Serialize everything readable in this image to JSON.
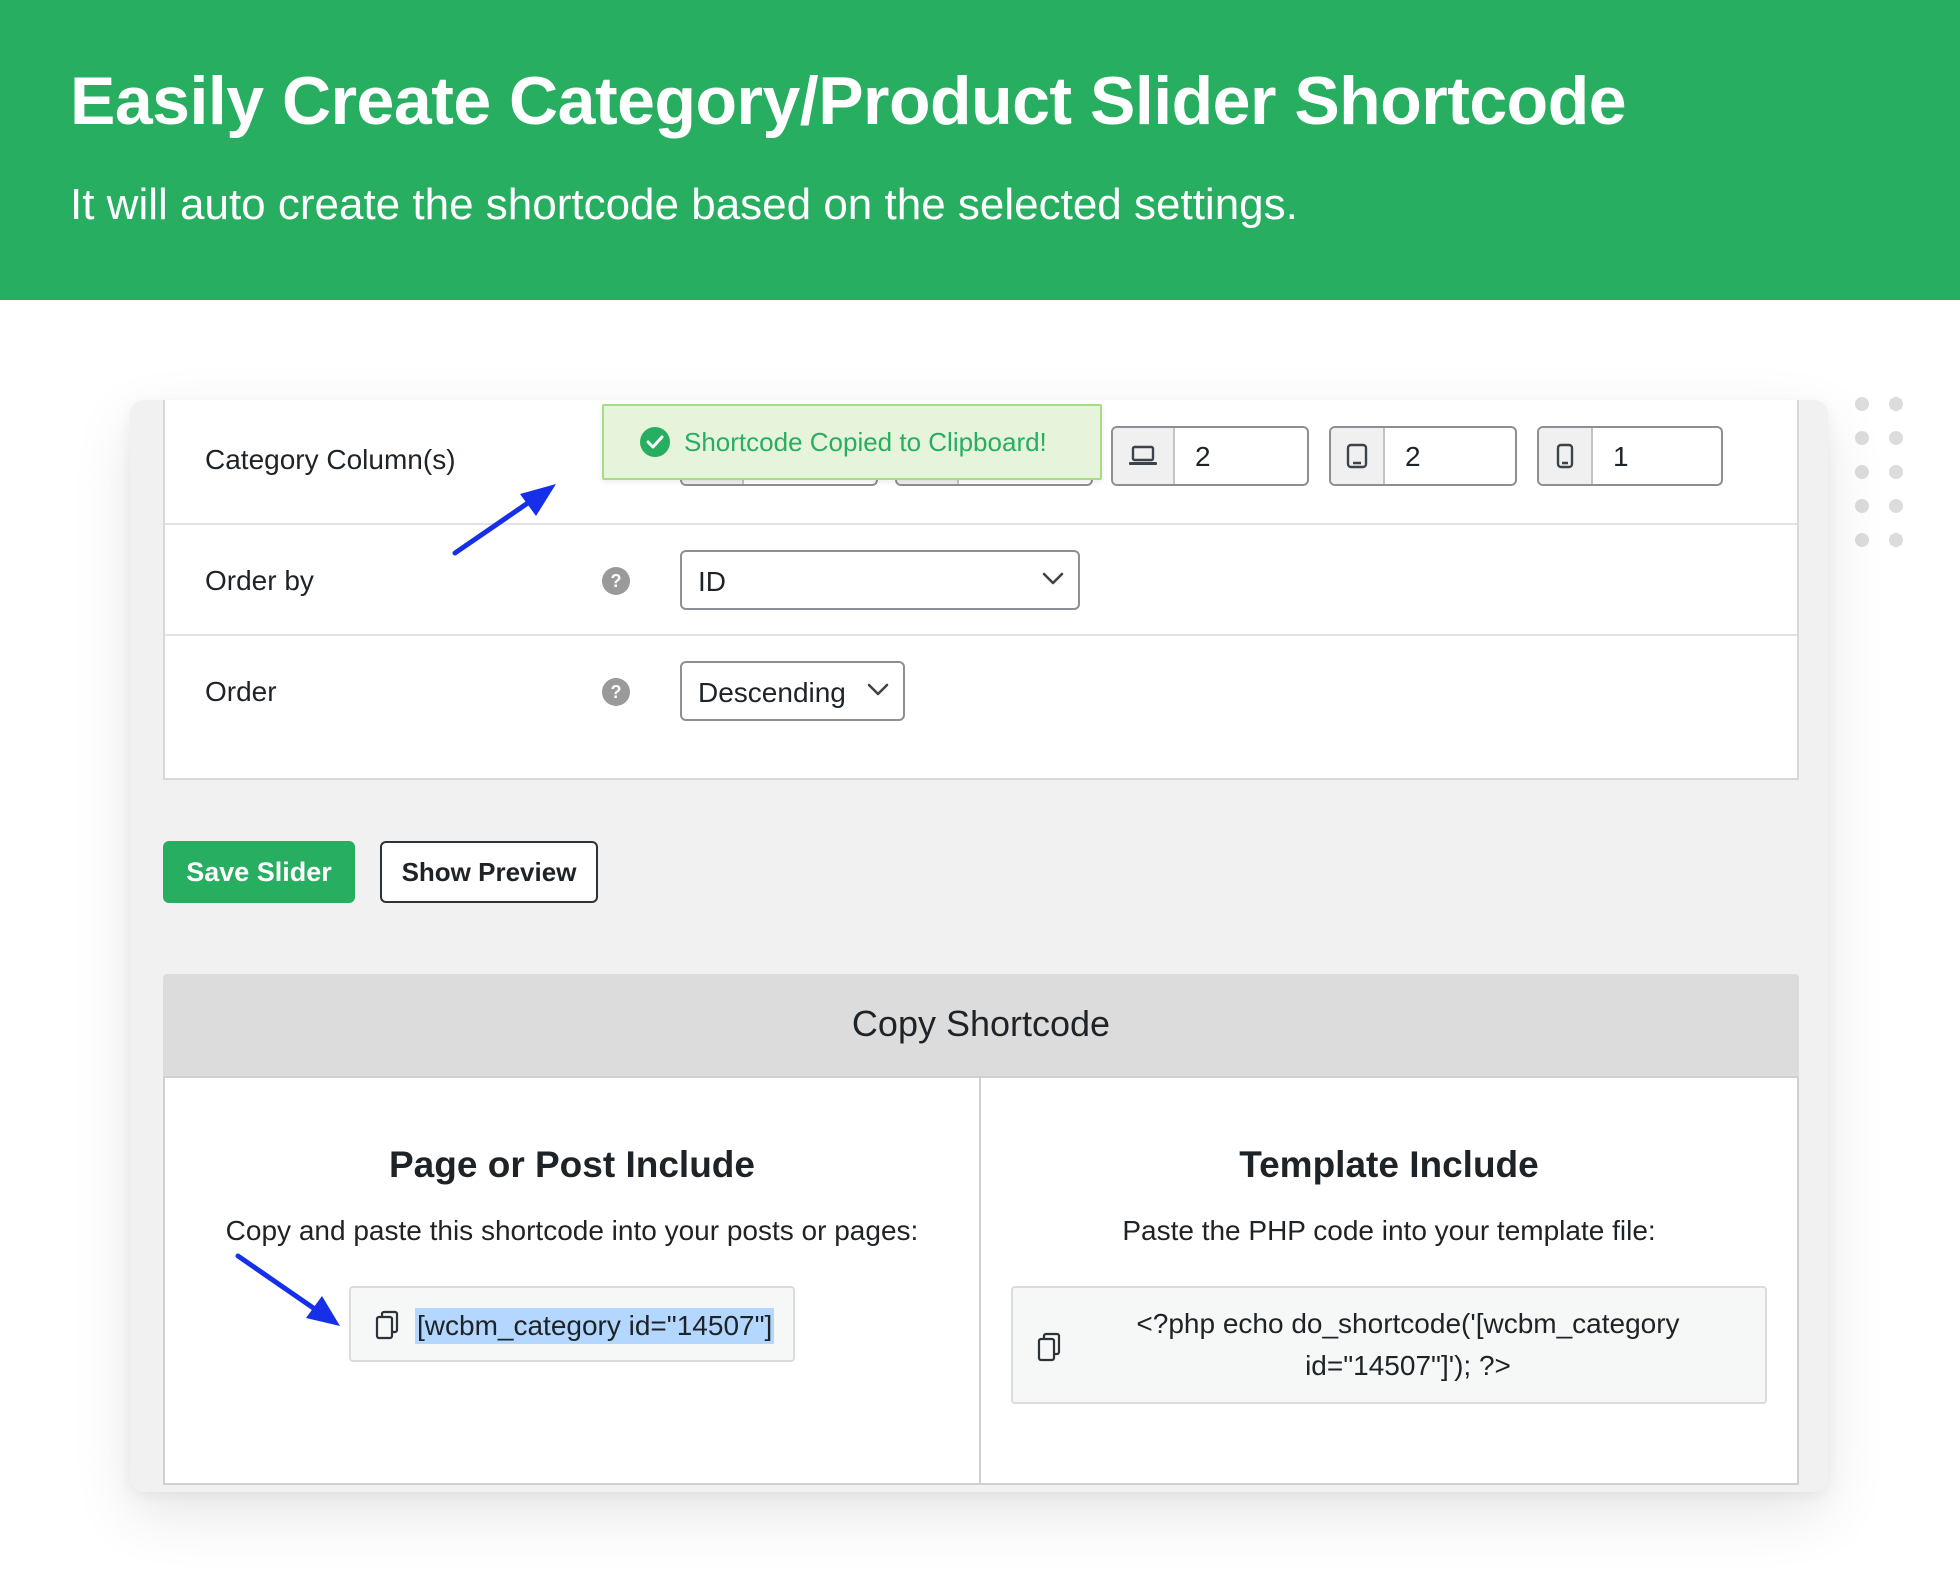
{
  "banner": {
    "title": "Easily Create Category/Product Slider Shortcode",
    "subtitle": "It will auto create the shortcode based on the selected settings.",
    "bg_color": "#27ae60"
  },
  "settings": {
    "category_columns_label": "Category Column(s)",
    "columns": [
      {
        "icon": "laptop-icon",
        "value": "2"
      },
      {
        "icon": "tablet-icon",
        "value": "2"
      },
      {
        "icon": "mobile-icon",
        "value": "1"
      }
    ],
    "order_by_label": "Order by",
    "order_by_value": "ID",
    "order_label": "Order",
    "order_value": "Descending"
  },
  "toast": {
    "message": "Shortcode Copied to Clipboard!",
    "color": "#27ae60"
  },
  "actions": {
    "save_label": "Save Slider",
    "preview_label": "Show Preview"
  },
  "copy_shortcode": {
    "heading": "Copy Shortcode",
    "page_include": {
      "title": "Page or Post Include",
      "description": "Copy and paste this shortcode into your posts or pages:",
      "shortcode": "[wcbm_category id=\"14507\"]"
    },
    "template_include": {
      "title": "Template Include",
      "description": "Paste the PHP code into your template file:",
      "code_line1": "<?php echo do_shortcode('[wcbm_category",
      "code_line2": "id=\"14507\"]'); ?>"
    }
  },
  "annotation_color": "#1530e8"
}
